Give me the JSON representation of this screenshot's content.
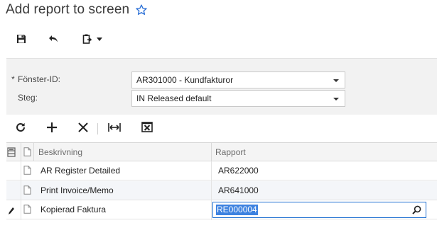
{
  "window": {
    "title": "Add report to screen"
  },
  "toolbar": {
    "save_icon": "save-icon",
    "undo_icon": "undo-icon",
    "clipboard_icon": "clipboard-icon"
  },
  "form": {
    "screen_id": {
      "label": "Fönster-ID:",
      "required_mark": "*",
      "value": "AR301000 - Kundfakturor"
    },
    "step": {
      "label": "Steg:",
      "value": "IN Released default"
    }
  },
  "grid_toolbar": {
    "refresh_icon": "refresh-icon",
    "add_icon": "plus-icon",
    "delete_icon": "close-icon",
    "fit_icon": "fit-columns-icon",
    "excel_icon": "excel-export-icon"
  },
  "grid": {
    "columns": [
      "Beskrivning",
      "Rapport"
    ],
    "rows": [
      {
        "description": "AR Register Detailed",
        "report": "AR622000"
      },
      {
        "description": "Print Invoice/Memo",
        "report": "AR641000"
      },
      {
        "description": "Kopierad Faktura",
        "report": "RE000004"
      }
    ],
    "editing_row": 2
  },
  "colors": {
    "accent": "#1f6fd1",
    "selection": "#3d82e0",
    "panel": "#f2f2f2"
  }
}
